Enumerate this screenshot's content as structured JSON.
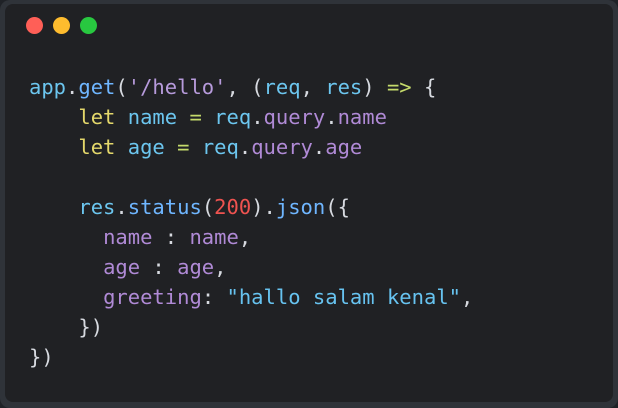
{
  "window": {
    "traffic_lights": [
      {
        "name": "close",
        "color": "#ff5f57"
      },
      {
        "name": "minimize",
        "color": "#febc2e"
      },
      {
        "name": "maximize",
        "color": "#28c840"
      }
    ]
  },
  "code": {
    "lines": [
      [
        {
          "t": "app",
          "k": "ident"
        },
        {
          "t": ".",
          "k": "plain"
        },
        {
          "t": "get",
          "k": "method"
        },
        {
          "t": "(",
          "k": "plain"
        },
        {
          "t": "'/hello'",
          "k": "string"
        },
        {
          "t": ", (",
          "k": "plain"
        },
        {
          "t": "req",
          "k": "param"
        },
        {
          "t": ", ",
          "k": "plain"
        },
        {
          "t": "res",
          "k": "param"
        },
        {
          "t": ") ",
          "k": "plain"
        },
        {
          "t": "=>",
          "k": "op"
        },
        {
          "t": " {",
          "k": "plain"
        }
      ],
      [
        {
          "t": "    ",
          "k": "plain"
        },
        {
          "t": "let",
          "k": "keyword"
        },
        {
          "t": " ",
          "k": "plain"
        },
        {
          "t": "name",
          "k": "ident"
        },
        {
          "t": " ",
          "k": "plain"
        },
        {
          "t": "=",
          "k": "op"
        },
        {
          "t": " ",
          "k": "plain"
        },
        {
          "t": "req",
          "k": "ident"
        },
        {
          "t": ".",
          "k": "plain"
        },
        {
          "t": "query",
          "k": "prop"
        },
        {
          "t": ".",
          "k": "plain"
        },
        {
          "t": "name",
          "k": "prop"
        }
      ],
      [
        {
          "t": "    ",
          "k": "plain"
        },
        {
          "t": "let",
          "k": "keyword"
        },
        {
          "t": " ",
          "k": "plain"
        },
        {
          "t": "age",
          "k": "ident"
        },
        {
          "t": " ",
          "k": "plain"
        },
        {
          "t": "=",
          "k": "op"
        },
        {
          "t": " ",
          "k": "plain"
        },
        {
          "t": "req",
          "k": "ident"
        },
        {
          "t": ".",
          "k": "plain"
        },
        {
          "t": "query",
          "k": "prop"
        },
        {
          "t": ".",
          "k": "plain"
        },
        {
          "t": "age",
          "k": "prop"
        }
      ],
      [],
      [
        {
          "t": "    ",
          "k": "plain"
        },
        {
          "t": "res",
          "k": "ident"
        },
        {
          "t": ".",
          "k": "plain"
        },
        {
          "t": "status",
          "k": "method"
        },
        {
          "t": "(",
          "k": "plain"
        },
        {
          "t": "200",
          "k": "number"
        },
        {
          "t": ").",
          "k": "plain"
        },
        {
          "t": "json",
          "k": "method"
        },
        {
          "t": "({",
          "k": "plain"
        }
      ],
      [
        {
          "t": "      ",
          "k": "plain"
        },
        {
          "t": "name",
          "k": "prop"
        },
        {
          "t": " : ",
          "k": "plain"
        },
        {
          "t": "name",
          "k": "prop"
        },
        {
          "t": ",",
          "k": "plain"
        }
      ],
      [
        {
          "t": "      ",
          "k": "plain"
        },
        {
          "t": "age",
          "k": "prop"
        },
        {
          "t": " : ",
          "k": "plain"
        },
        {
          "t": "age",
          "k": "prop"
        },
        {
          "t": ",",
          "k": "plain"
        }
      ],
      [
        {
          "t": "      ",
          "k": "plain"
        },
        {
          "t": "greeting",
          "k": "prop"
        },
        {
          "t": ": ",
          "k": "plain"
        },
        {
          "t": "\"hallo salam kenal\"",
          "k": "str2"
        },
        {
          "t": ",",
          "k": "plain"
        }
      ],
      [
        {
          "t": "    ",
          "k": "plain"
        },
        {
          "t": "})",
          "k": "plain"
        }
      ],
      [
        {
          "t": "})",
          "k": "plain"
        }
      ]
    ]
  }
}
